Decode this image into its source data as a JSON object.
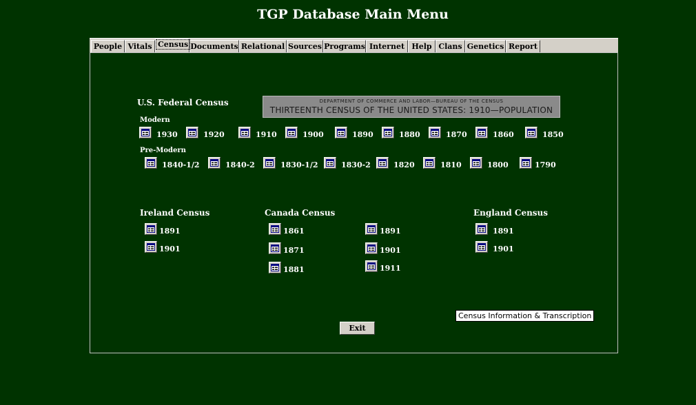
{
  "window": {
    "title": "TGP Database Main Menu"
  },
  "tabs": [
    {
      "label": "People"
    },
    {
      "label": "Vitals"
    },
    {
      "label": "Census",
      "active": true
    },
    {
      "label": "Documents"
    },
    {
      "label": "Relational"
    },
    {
      "label": "Sources"
    },
    {
      "label": "Programs"
    },
    {
      "label": "Internet"
    },
    {
      "label": "Help"
    },
    {
      "label": "Clans"
    },
    {
      "label": "Genetics"
    },
    {
      "label": "Report"
    }
  ],
  "us_census": {
    "heading": "U.S. Federal Census",
    "banner": {
      "line1": "DEPARTMENT OF COMMERCE AND LABOR—BUREAU OF THE CENSUS",
      "line2": "THIRTEENTH CENSUS OF THE UNITED STATES: 1910—POPULATION"
    },
    "modern": {
      "label": "Modern",
      "years": [
        "1930",
        "1920",
        "1910",
        "1900",
        "1890",
        "1880",
        "1870",
        "1860",
        "1850"
      ]
    },
    "pre_modern": {
      "label": "Pre-Modern",
      "years": [
        "1840-1/2",
        "1840-2",
        "1830-1/2",
        "1830-2",
        "1820",
        "1810",
        "1800",
        "1790"
      ]
    }
  },
  "ireland_census": {
    "heading": "Ireland Census",
    "years": [
      "1891",
      "1901"
    ]
  },
  "canada_census": {
    "heading": "Canada Census",
    "col1": [
      "1861",
      "1871",
      "1881"
    ],
    "col2": [
      "1891",
      "1901",
      "1911"
    ]
  },
  "england_census": {
    "heading": "England Census",
    "years": [
      "1891",
      "1901"
    ]
  },
  "tooltip": "Census Information & Transcription",
  "exit_label": "Exit",
  "colors": {
    "background": "#003300",
    "tab_face": "#d4d0c8",
    "text": "#ffffff"
  },
  "icon": "form-icon"
}
